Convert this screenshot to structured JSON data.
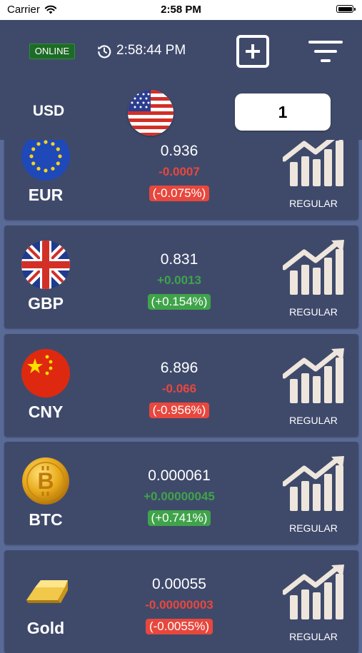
{
  "status_bar": {
    "carrier": "Carrier",
    "time": "2:58 PM"
  },
  "header": {
    "connection_status": "ONLINE",
    "last_updated": "2:58:44 PM",
    "base_currency": "USD",
    "amount": "1",
    "icons": {
      "refresh": "refresh-clock-icon",
      "add": "add-square-icon",
      "filter": "filter-icon",
      "base_flag": "us-flag-icon"
    }
  },
  "currencies": [
    {
      "code": "EUR",
      "rate": "0.936",
      "change": "-0.0007",
      "percent": "(-0.075%)",
      "direction": "down",
      "type": "REGULAR",
      "icon": "eu-flag-icon"
    },
    {
      "code": "GBP",
      "rate": "0.831",
      "change": "+0.0013",
      "percent": "(+0.154%)",
      "direction": "up",
      "type": "REGULAR",
      "icon": "uk-flag-icon"
    },
    {
      "code": "CNY",
      "rate": "6.896",
      "change": "-0.066",
      "percent": "(-0.956%)",
      "direction": "down",
      "type": "REGULAR",
      "icon": "china-flag-icon"
    },
    {
      "code": "BTC",
      "rate": "0.000061",
      "change": "+0.00000045",
      "percent": "(+0.741%)",
      "direction": "up",
      "type": "REGULAR",
      "icon": "bitcoin-icon"
    },
    {
      "code": "Gold",
      "rate": "0.00055",
      "change": "-0.00000003",
      "percent": "(-0.0055%)",
      "direction": "down",
      "type": "REGULAR",
      "icon": "gold-bar-icon"
    }
  ],
  "colors": {
    "background": "#5a6a97",
    "card": "#3f4a6b",
    "negative": "#e8473d",
    "positive": "#3fa34a",
    "online_badge": "#1d6b26"
  }
}
